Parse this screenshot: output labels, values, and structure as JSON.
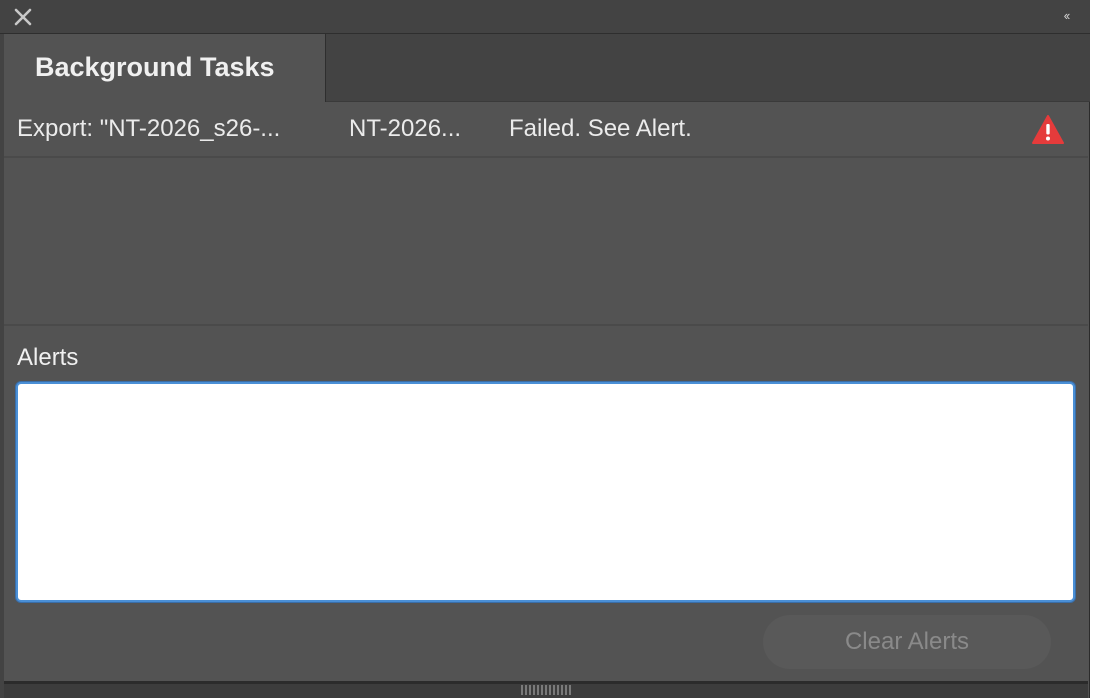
{
  "window": {
    "close_icon": "close-icon",
    "collapse_icon": "double-chevron-left-icon",
    "collapse_glyph": "‹‹"
  },
  "tabs": [
    {
      "label": "Background Tasks",
      "active": true
    }
  ],
  "tasks": [
    {
      "name": "Export: \"NT-2026_s26-...",
      "document": "NT-2026...",
      "status": "Failed. See Alert.",
      "status_icon": "warning-icon"
    }
  ],
  "alerts": {
    "label": "Alerts",
    "content": ""
  },
  "buttons": {
    "clear_alerts": "Clear Alerts"
  },
  "colors": {
    "panel_bg": "#535353",
    "header_bg": "#434343",
    "warning_red": "#e53b3b",
    "focus_blue": "#4a8fd6"
  }
}
